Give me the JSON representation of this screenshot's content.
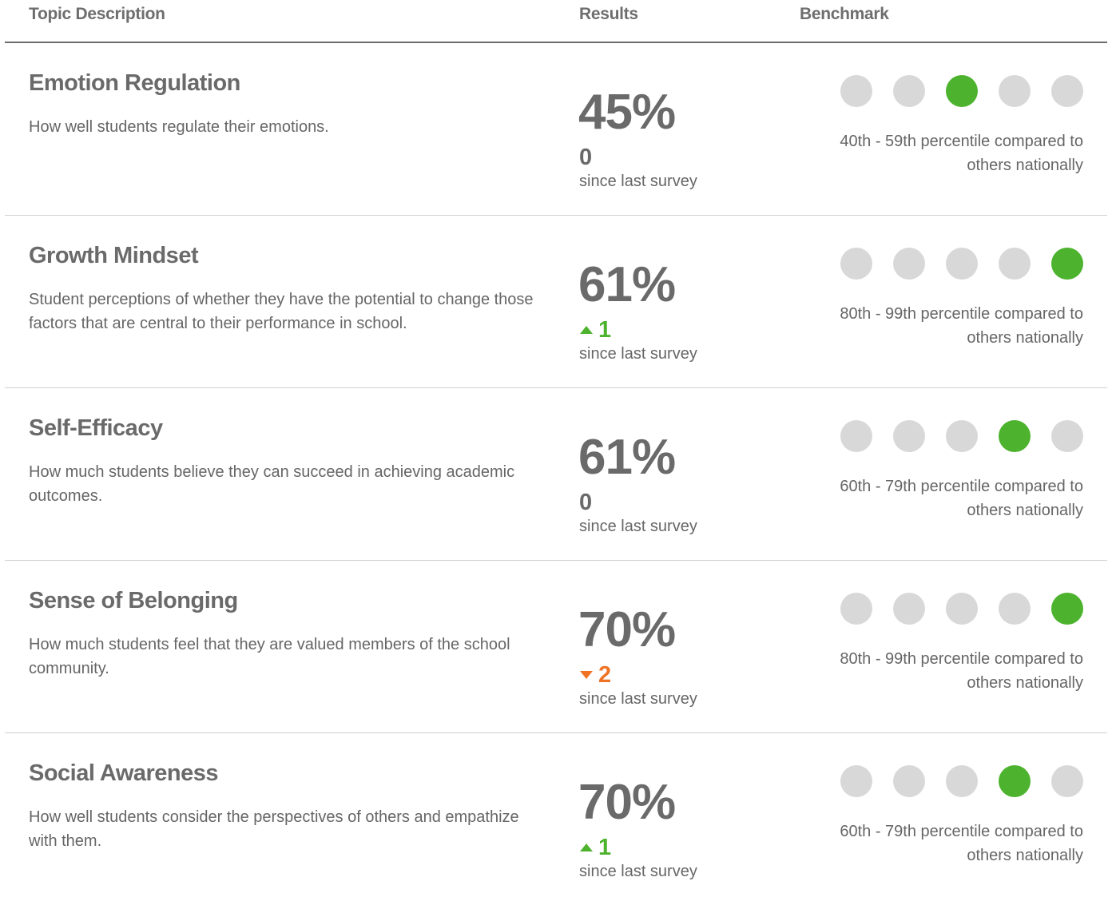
{
  "header": {
    "topic": "Topic Description",
    "results": "Results",
    "benchmark": "Benchmark"
  },
  "since_label": "since last survey",
  "colors": {
    "active_dot": "#4db32e",
    "inactive_dot": "#d8d8d8",
    "up": "#4db32e",
    "down": "#f07324",
    "neutral": "#6a6a6a"
  },
  "rows": [
    {
      "title": "Emotion Regulation",
      "description": "How well students regulate their emotions.",
      "result": "45%",
      "change": "0",
      "direction": "neutral",
      "benchmark_level": 3,
      "benchmark_text": "40th - 59th percentile compared to others nationally"
    },
    {
      "title": "Growth Mindset",
      "description": "Student perceptions of whether they have the potential to change those factors that are central to their performance in school.",
      "result": "61%",
      "change": "1",
      "direction": "up",
      "benchmark_level": 5,
      "benchmark_text": "80th - 99th percentile compared to others nationally"
    },
    {
      "title": "Self-Efficacy",
      "description": "How much students believe they can succeed in achieving academic outcomes.",
      "result": "61%",
      "change": "0",
      "direction": "neutral",
      "benchmark_level": 4,
      "benchmark_text": "60th - 79th percentile compared to others nationally"
    },
    {
      "title": "Sense of Belonging",
      "description": "How much students feel that they are valued members of the school community.",
      "result": "70%",
      "change": "2",
      "direction": "down",
      "benchmark_level": 5,
      "benchmark_text": "80th - 99th percentile compared to others nationally"
    },
    {
      "title": "Social Awareness",
      "description": "How well students consider the perspectives of others and empathize with them.",
      "result": "70%",
      "change": "1",
      "direction": "up",
      "benchmark_level": 4,
      "benchmark_text": "60th - 79th percentile compared to others nationally"
    }
  ]
}
